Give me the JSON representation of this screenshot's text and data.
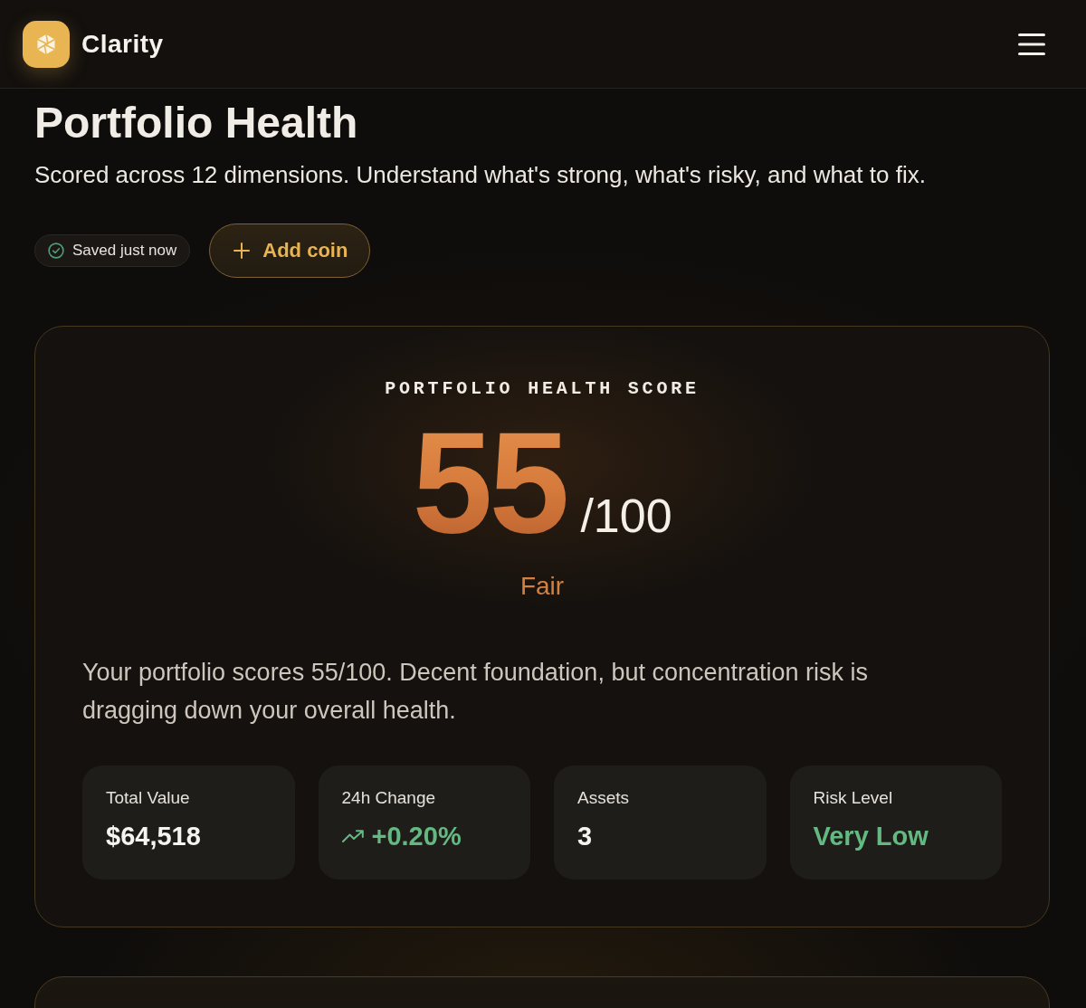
{
  "header": {
    "brand": "Clarity"
  },
  "page": {
    "title": "Portfolio Health",
    "subtitle": "Scored across 12 dimensions. Understand what's strong, what's risky, and what to fix."
  },
  "actions": {
    "save_status": {
      "label": "Saved just now"
    },
    "add_button": {
      "label": "Add coin"
    }
  },
  "score_card": {
    "label": "PORTFOLIO HEALTH SCORE",
    "score": "55",
    "max": "/100",
    "rating": "Fair",
    "summary": "Your portfolio scores 55/100. Decent foundation, but concentration risk is dragging down your overall health.",
    "stats": [
      {
        "label": "Total Value",
        "value": "$64,518",
        "kind": "plain"
      },
      {
        "label": "24h Change",
        "value": "+0.20%",
        "kind": "up"
      },
      {
        "label": "Assets",
        "value": "3",
        "kind": "plain"
      },
      {
        "label": "Risk Level",
        "value": "Very Low",
        "kind": "good"
      }
    ]
  }
}
